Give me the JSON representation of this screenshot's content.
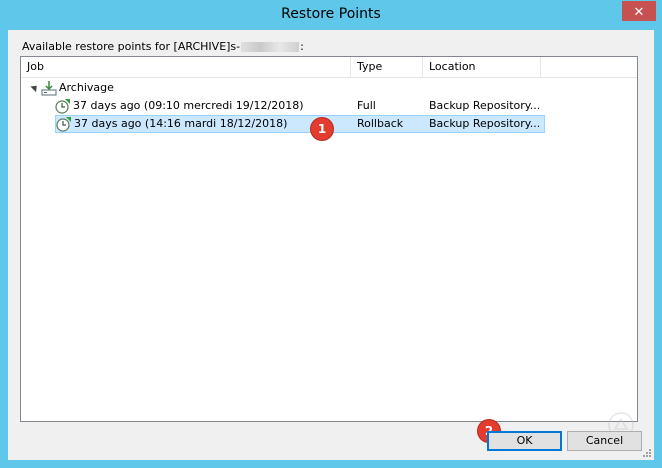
{
  "window": {
    "title": "Restore Points",
    "close_label": "✕"
  },
  "caption": {
    "prefix": "Available restore points for [ARCHIVE]s-",
    "suffix": ":"
  },
  "columns": {
    "job": "Job",
    "type": "Type",
    "location": "Location"
  },
  "tree": {
    "group_label": "Archivage",
    "points": [
      {
        "label": "37 days ago (09:10 mercredi 19/12/2018)",
        "type": "Full",
        "location": "Backup Repository..."
      },
      {
        "label": "37 days ago (14:16 mardi 18/12/2018)",
        "type": "Rollback",
        "location": "Backup Repository..."
      }
    ]
  },
  "callouts": {
    "first": "1",
    "second": "2"
  },
  "buttons": {
    "ok": "OK",
    "cancel": "Cancel"
  }
}
